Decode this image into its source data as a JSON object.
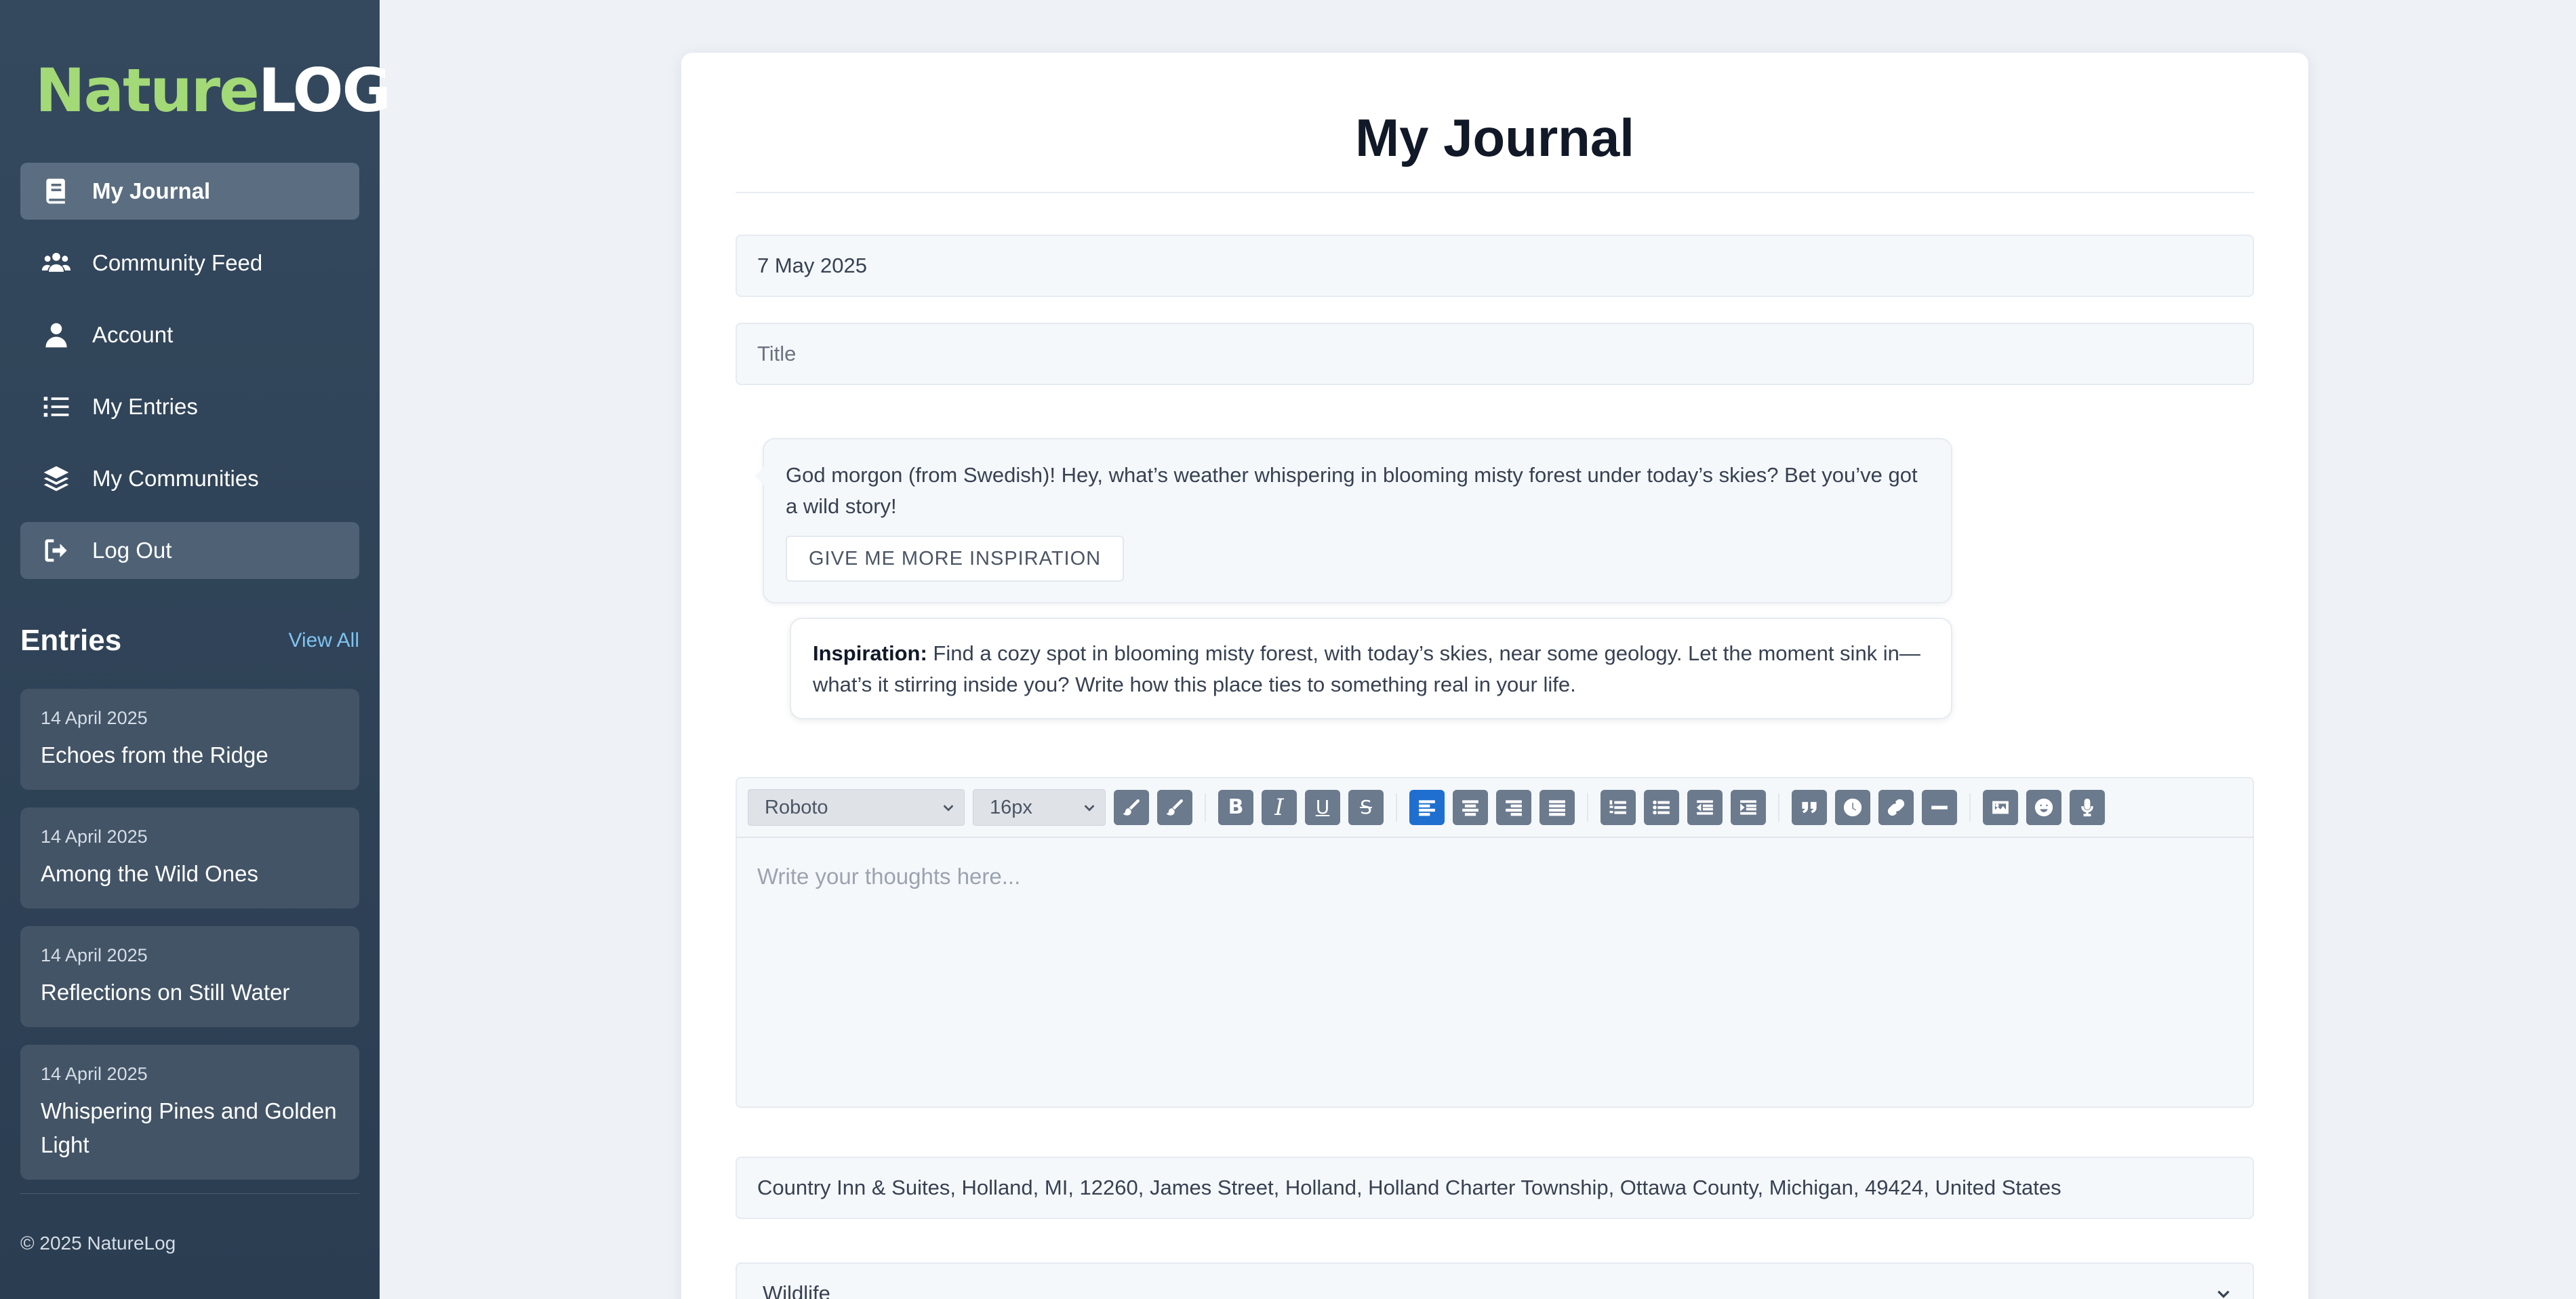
{
  "sidebar": {
    "logo": {
      "part1": "Nature",
      "part2": "LOG"
    },
    "nav": [
      {
        "label": "My Journal",
        "icon": "book-icon"
      },
      {
        "label": "Community Feed",
        "icon": "users-icon"
      },
      {
        "label": "Account",
        "icon": "user-icon"
      },
      {
        "label": "My Entries",
        "icon": "list-icon"
      },
      {
        "label": "My Communities",
        "icon": "layers-icon"
      },
      {
        "label": "Log Out",
        "icon": "logout-icon"
      }
    ],
    "entries_title": "Entries",
    "view_all": "View All",
    "entries": [
      {
        "date": "14 April 2025",
        "title": "Echoes from the Ridge"
      },
      {
        "date": "14 April 2025",
        "title": "Among the Wild Ones"
      },
      {
        "date": "14 April 2025",
        "title": "Reflections on Still Water"
      },
      {
        "date": "14 April 2025",
        "title": "Whispering Pines and Golden Light"
      }
    ],
    "copyright": "© 2025 NatureLog"
  },
  "main": {
    "title": "My Journal",
    "date_value": "7 May 2025",
    "title_placeholder": "Title",
    "prompt_text": "God morgon (from Swedish)! Hey, what’s weather whispering in blooming misty forest under today’s skies? Bet you’ve got a wild story!",
    "inspire_button": "GIVE ME MORE INSPIRATION",
    "inspiration_label": "Inspiration:",
    "inspiration_text": "Find a cozy spot in blooming misty forest, with today’s skies, near some geology. Let the moment sink in—what’s it stirring inside you? Write how this place ties to something real in your life.",
    "editor": {
      "font": "Roboto",
      "size": "16px",
      "placeholder": "Write your thoughts here..."
    },
    "location_value": "Country Inn & Suites, Holland, MI, 12260, James Street, Holland, Holland Charter Township, Ottawa County, Michigan, 49424, United States",
    "category_value": "Wildlife"
  },
  "colors": {
    "sidebar_bg": "#34495e",
    "logo_green": "#a3d977",
    "accent_blue": "#1f6fd1",
    "link_blue": "#7fc3f0"
  }
}
